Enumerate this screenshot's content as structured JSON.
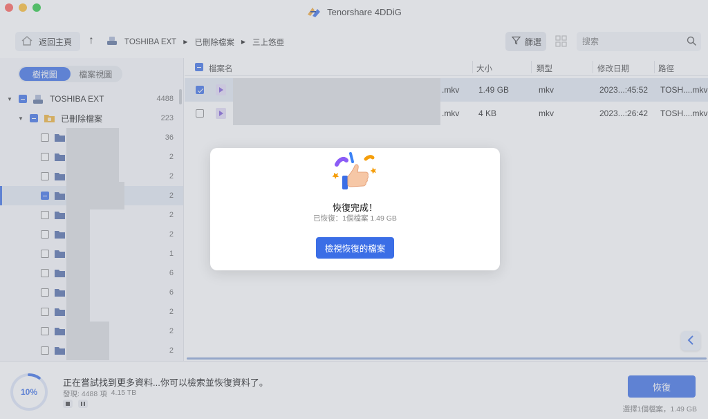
{
  "window": {
    "title": "Tenorshare 4DDiG"
  },
  "toolbar": {
    "home_label": "返回主頁",
    "breadcrumb": [
      "TOSHIBA EXT",
      "已刪除檔案",
      "三上悠亜"
    ],
    "filter_label": "篩選",
    "search_placeholder": "搜索"
  },
  "sidebar": {
    "tabs": [
      "樹視圖",
      "檔案視圖"
    ],
    "tree": [
      {
        "label": "TOSHIBA EXT",
        "count": "4488"
      },
      {
        "label": "已刪除檔案",
        "count": "223"
      }
    ],
    "folder_counts": [
      "36",
      "2",
      "2",
      "2",
      "2",
      "2",
      "1",
      "6",
      "6",
      "2",
      "2",
      "2"
    ]
  },
  "file_list": {
    "columns": [
      "檔案名",
      "大小",
      "類型",
      "修改日期",
      "路徑"
    ],
    "rows": [
      {
        "name_suffix": ".mkv",
        "size": "1.49 GB",
        "type": "mkv",
        "modified": "2023...:45:52",
        "path": "TOSH....mkv",
        "checked": true
      },
      {
        "name_suffix": ".mkv",
        "size": "4 KB",
        "type": "mkv",
        "modified": "2023...:26:42",
        "path": "TOSH....mkv",
        "checked": false
      }
    ]
  },
  "footer": {
    "progress": "10%",
    "progress_value": 0.1,
    "status": "正在嘗試找到更多資料...你可以檢索並恢復資料了。",
    "found_label": "發現: 4488 項",
    "found_size": "4.15 TB",
    "recover_label": "恢復",
    "selection_note": "選擇1個檔案，1.49 GB"
  },
  "dialog": {
    "title": "恢復完成！",
    "subtitle": "已恢復：1個檔案 1.49 GB",
    "button_label": "檢視恢復的檔案"
  },
  "colors": {
    "accent": "#3b6ee6"
  }
}
